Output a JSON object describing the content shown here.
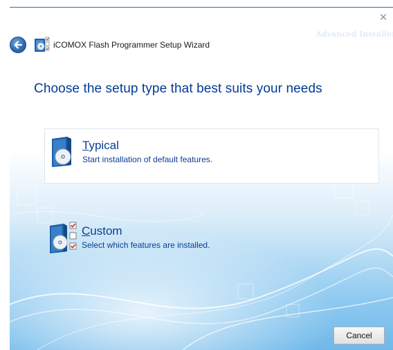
{
  "window": {
    "close_glyph": "✕",
    "watermark": "Advanced Installer"
  },
  "header": {
    "back_icon": "back-arrow-icon",
    "app_icon": "installer-app-icon",
    "title": "iCOMOX Flash Programmer Setup Wizard"
  },
  "heading": "Choose the setup type that best suits your needs",
  "options": [
    {
      "icon": "disc-package-icon",
      "accel": "T",
      "title_rest": "ypical",
      "description": "Start installation of default features."
    },
    {
      "icon": "disc-package-checklist-icon",
      "accel": "C",
      "title_rest": "ustom",
      "description": "Select which features are installed."
    }
  ],
  "buttons": {
    "cancel_label": "Cancel"
  },
  "colors": {
    "heading": "#003a96",
    "link_text": "#0a3d91",
    "accent": "#2d6eb4"
  }
}
